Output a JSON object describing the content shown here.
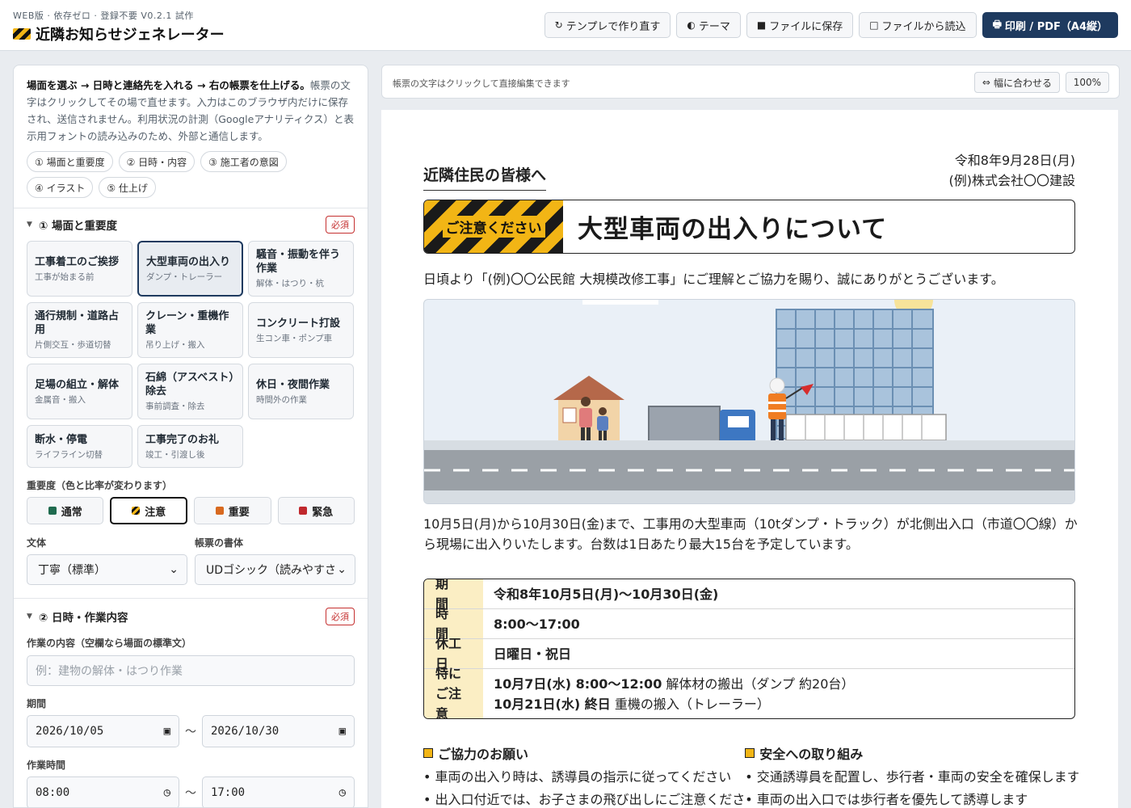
{
  "header": {
    "subtitle": "WEB版 · 依存ゼロ · 登録不要 V0.2.1 試作",
    "title": "近隣お知らせジェネレーター",
    "buttons": [
      {
        "icon": "↻",
        "label": "テンプレで作り直す"
      },
      {
        "icon": "◐",
        "label": "テーマ"
      },
      {
        "icon": "■",
        "label": "ファイルに保存"
      },
      {
        "icon": "□",
        "label": "ファイルから読込"
      },
      {
        "icon": "🖶",
        "label": "印刷 / PDF（A4縦）"
      }
    ]
  },
  "left": {
    "intro_bold": "場面を選ぶ → 日時と連絡先を入れる → 右の帳票を仕上げる。",
    "intro_rest": "帳票の文字はクリックしてその場で直せます。入力はこのブラウザ内だけに保存され、送信されません。利用状況の計測（Googleアナリティクス）と表示用フォントの読み込みのため、外部と通信します。",
    "chips": [
      "① 場面と重要度",
      "② 日時・内容",
      "③ 施工者の意図",
      "④ イラスト",
      "⑤ 仕上げ"
    ],
    "section1": {
      "title": "① 場面と重要度",
      "required": "必須"
    },
    "scenes": [
      {
        "title": "工事着工のご挨拶",
        "sub": "工事が始まる前"
      },
      {
        "title": "大型車両の出入り",
        "sub": "ダンプ・トレーラー"
      },
      {
        "title": "騒音・振動を伴う作業",
        "sub": "解体・はつり・杭"
      },
      {
        "title": "通行規制・道路占用",
        "sub": "片側交互・歩道切替"
      },
      {
        "title": "クレーン・重機作業",
        "sub": "吊り上げ・搬入"
      },
      {
        "title": "コンクリート打設",
        "sub": "生コン車・ポンプ車"
      },
      {
        "title": "足場の組立・解体",
        "sub": "金属音・搬入"
      },
      {
        "title": "石綿（アスベスト）除去",
        "sub": "事前調査・除去"
      },
      {
        "title": "休日・夜間作業",
        "sub": "時間外の作業"
      },
      {
        "title": "断水・停電",
        "sub": "ライフライン切替"
      },
      {
        "title": "工事完了のお礼",
        "sub": "竣工・引渡し後"
      }
    ],
    "severity_label": "重要度（色と比率が変わります）",
    "severities": [
      {
        "label": "通常",
        "color": "#1f6b4f"
      },
      {
        "label": "注意",
        "color": "#f2b515"
      },
      {
        "label": "重要",
        "color": "#d8691f"
      },
      {
        "label": "緊急",
        "color": "#c0282d"
      }
    ],
    "style_label": "文体",
    "style_value": "丁寧（標準）",
    "font_label": "帳票の書体",
    "font_value": "UDゴシック（読みやすさ",
    "section2": {
      "title": "② 日時・作業内容",
      "required": "必須"
    },
    "work_label": "作業の内容（空欄なら場面の標準文）",
    "work_placeholder": "例：建物の解体・はつり作業",
    "period_label": "期間",
    "date_from": "2026/10/05",
    "date_to": "2026/10/30",
    "time_label": "作業時間",
    "time_from": "08:00",
    "time_to": "17:00",
    "tilde": "〜"
  },
  "preview": {
    "hint": "帳票の文字はクリックして直接編集できます",
    "fit_label": "幅に合わせる",
    "zoom": "100%"
  },
  "notice": {
    "to": "近隣住民の皆様へ",
    "date": "令和8年9月28日(月)",
    "company": "(例)株式会社〇〇建設",
    "tag": "ご注意ください",
    "title": "大型車両の出入りについて",
    "lead": "日頃より「(例)〇〇公民館 大規模改修工事」にご理解とご協力を賜り、誠にありがとうございます。",
    "body": "10月5日(月)から10月30日(金)まで、工事用の大型車両（10tダンプ・トラック）が北側出入口（市道〇〇線）から現場に出入りいたします。台数は1日あたり最大15台を予定しています。",
    "schedule": [
      {
        "key": "期　間",
        "value": "令和8年10月5日(月)〜10月30日(金)"
      },
      {
        "key": "時　間",
        "value": "8:00〜17:00"
      },
      {
        "key": "休工日",
        "value": "日曜日・祝日"
      }
    ],
    "special": {
      "key1": "特に",
      "key2": "ご注意",
      "line1_bold": "10月7日(水) 8:00〜12:00",
      "line1_rest": " 解体材の搬出（ダンプ 約20台）",
      "line2_bold": "10月21日(水) 終日",
      "line2_rest": " 重機の搬入（トレーラー）"
    },
    "cooperation": {
      "title": "ご協力のお願い",
      "items": [
        "車両の出入り時は、誘導員の指示に従ってください",
        "出入口付近では、お子さまの飛び出しにご注意くださ"
      ]
    },
    "safety": {
      "title": "安全への取り組み",
      "items": [
        "交通誘導員を配置し、歩行者・車両の安全を確保します",
        "車両の出入口では歩行者を優先して誘導します"
      ]
    }
  }
}
